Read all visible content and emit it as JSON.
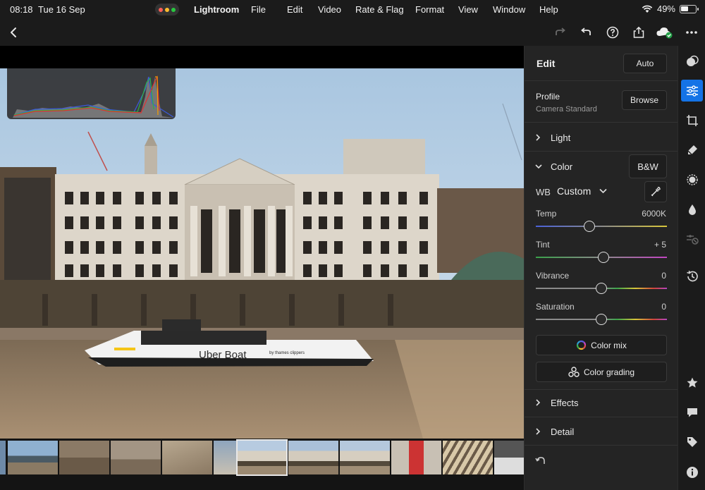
{
  "status": {
    "time": "08:18",
    "date": "Tue 16 Sep",
    "battery": "49%"
  },
  "menu": {
    "app": "Lightroom",
    "items": [
      "File",
      "Edit",
      "Video",
      "Rate & Flag",
      "Format",
      "View",
      "Window",
      "Help"
    ]
  },
  "toolbar": {
    "icons": [
      "back-icon",
      "redo-icon",
      "undo-icon",
      "help-icon",
      "share-icon",
      "cloud-sync-icon",
      "more-icon"
    ]
  },
  "edit": {
    "title": "Edit",
    "auto_label": "Auto",
    "profile": {
      "label": "Profile",
      "value": "Camera Standard",
      "browse_label": "Browse"
    },
    "sections": {
      "light": "Light",
      "color": "Color",
      "effects": "Effects",
      "detail": "Detail"
    },
    "bw_label": "B&W",
    "wb": {
      "label": "WB",
      "value": "Custom"
    },
    "sliders": [
      {
        "label": "Temp",
        "value": "6000K",
        "position": 0.41
      },
      {
        "label": "Tint",
        "value": "+ 5",
        "position": 0.52
      },
      {
        "label": "Vibrance",
        "value": "0",
        "position": 0.5
      },
      {
        "label": "Saturation",
        "value": "0",
        "position": 0.5
      }
    ],
    "color_mix_label": "Color mix",
    "color_grading_label": "Color grading"
  },
  "photo": {
    "boat_text": "Uber Boat",
    "boat_sub": "by thames clippers"
  },
  "rail": {
    "icons": [
      "presets-icon",
      "edit-sliders-icon",
      "crop-icon",
      "healing-icon",
      "masking-icon",
      "optics-icon",
      "versions-off-icon",
      "history-icon",
      "star-icon",
      "comment-icon",
      "tag-icon",
      "info-icon"
    ]
  },
  "colors": {
    "accent": "#1473e6",
    "panel": "#242424",
    "background": "#1b1b1b"
  }
}
